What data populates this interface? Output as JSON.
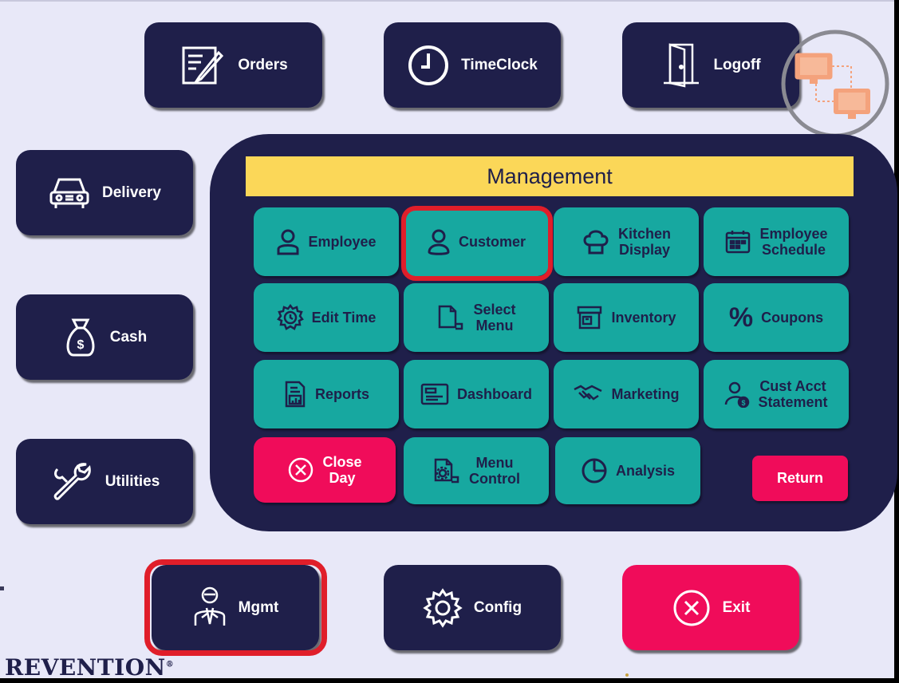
{
  "top_nav": {
    "orders": "Orders",
    "timeclock": "TimeClock",
    "logoff": "Logoff"
  },
  "side_nav": {
    "delivery": "Delivery",
    "cash": "Cash",
    "utilities": "Utilities"
  },
  "bottom_nav": {
    "mgmt": "Mgmt",
    "config": "Config",
    "exit": "Exit"
  },
  "management": {
    "title": "Management",
    "tiles": {
      "employee": "Employee",
      "customer": "Customer",
      "kitchen_display": [
        "Kitchen",
        "Display"
      ],
      "employee_schedule": [
        "Employee",
        "Schedule"
      ],
      "edit_time": "Edit Time",
      "select_menu": [
        "Select",
        "Menu"
      ],
      "inventory": "Inventory",
      "coupons": "Coupons",
      "reports": "Reports",
      "dashboard": "Dashboard",
      "marketing": "Marketing",
      "cust_acct_statement": [
        "Cust Acct",
        "Statement"
      ],
      "close_day": [
        "Close",
        "Day"
      ],
      "menu_control": [
        "Menu",
        "Control"
      ],
      "analysis": "Analysis"
    },
    "return": "Return"
  },
  "brand": {
    "name": "REVENTION",
    "mark": "®"
  },
  "icons": {
    "orders": "edit-document-icon",
    "timeclock": "clock-icon",
    "logoff": "door-icon",
    "delivery": "car-icon",
    "cash": "money-bag-icon",
    "utilities": "wrench-icon",
    "mgmt": "manager-icon",
    "config": "gear-icon",
    "exit": "close-circle-icon",
    "network": "network-status-icon"
  },
  "colors": {
    "navy": "#1f1f4a",
    "teal": "#17a8a0",
    "red": "#f00c5a",
    "yellow": "#fbd758",
    "background": "#e8e8f8",
    "highlight": "#e01e2a",
    "network_orange": "#f4a27c"
  }
}
